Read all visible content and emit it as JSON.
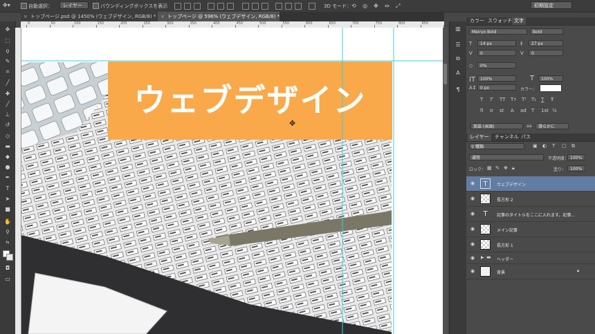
{
  "options_bar": {
    "auto_select_label": "自動選択：",
    "auto_select_target": "レイヤー",
    "show_bounding_box_label": "バウンディングボックスを表示",
    "mode3d_label": "3D モード：",
    "workspace": "初期設定"
  },
  "tabs": [
    {
      "label": "トップページ.psd @ 1450% (ウェブデザイン, RGB/8) *",
      "active": false
    },
    {
      "label": "トップページ @ 596% (ウェブデザイン, RGB/8) *",
      "active": true
    }
  ],
  "ruler": {
    "labels": [
      "0",
      "50",
      "100",
      "150",
      "200",
      "250",
      "300",
      "350",
      "400",
      "450",
      "500",
      "550",
      "600",
      "650",
      "700",
      "750",
      "800",
      "850",
      "900"
    ]
  },
  "canvas": {
    "banner_text": "ウェブデザイン",
    "banner_color": "#f9a94a",
    "guide_color": "#35d0e8"
  },
  "character_panel": {
    "tabs": [
      "カラー",
      "スウォッチ",
      "文字"
    ],
    "active_tab": "文字",
    "font_family": "Meiryo Bold",
    "font_style": "Bold",
    "font_size": "14 px",
    "leading": "27 px",
    "kerning": "0",
    "tracking": "0",
    "tsume": "0%",
    "vertical_scale": "100%",
    "horizontal_scale": "100%",
    "baseline_shift": "0 px",
    "color_label": "カラー：",
    "color_value": "#ffffff",
    "style_buttons": [
      "T",
      "T",
      "TT",
      "Tт",
      "T¹",
      "T₁",
      "T",
      "Ŧ"
    ],
    "opentype_buttons": [
      "fi",
      "ơ",
      "st",
      "A",
      "ad",
      "T",
      "1st",
      "½"
    ],
    "language": "英語 (米国)",
    "aa_label": "aa",
    "antialias": "滑らかに"
  },
  "layers_panel": {
    "tabs": [
      "レイヤー",
      "チャンネル",
      "パス"
    ],
    "active_tab": "レイヤー",
    "filter_kind": "種類",
    "blend_mode": "通常",
    "opacity_label": "不透明度：",
    "opacity": "100%",
    "lock_label": "ロック：",
    "fill_label": "塗り：",
    "fill": "100%",
    "layers": [
      {
        "name": "ウェブデザイン",
        "type": "text",
        "selected": true
      },
      {
        "name": "長方形 2",
        "type": "shape",
        "selected": false
      },
      {
        "name": "記事のタイトルをここに入れます。記事...",
        "type": "text",
        "selected": false
      },
      {
        "name": "メイン記事",
        "type": "shape",
        "selected": false
      },
      {
        "name": "長方形 1",
        "type": "shape",
        "selected": false
      },
      {
        "name": "ヘッダー",
        "type": "group",
        "selected": false
      },
      {
        "name": "背景",
        "type": "background",
        "selected": false
      }
    ]
  }
}
